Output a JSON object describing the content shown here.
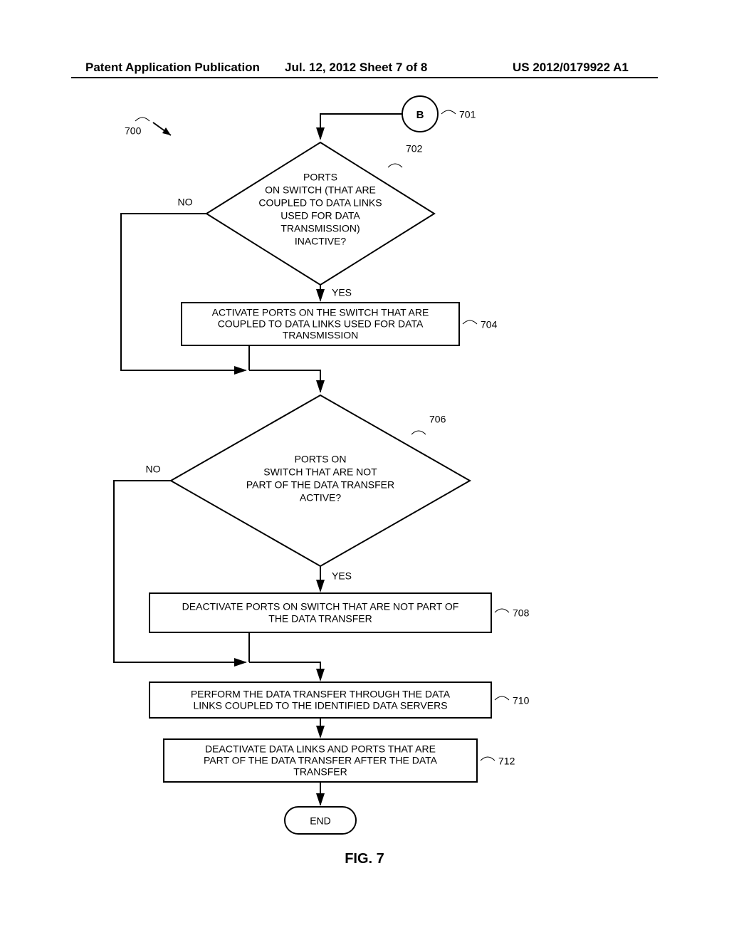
{
  "header": {
    "left": "Patent Application Publication",
    "mid": "Jul. 12, 2012  Sheet 7 of 8",
    "right": "US 2012/0179922 A1"
  },
  "labels": {
    "ref700": "700",
    "ref701": "701",
    "ref702": "702",
    "ref704": "704",
    "ref706": "706",
    "ref708": "708",
    "ref710": "710",
    "ref712": "712"
  },
  "nodes": {
    "start": "B",
    "d702_l1": "PORTS",
    "d702_l2": "ON SWITCH (THAT ARE",
    "d702_l3": "COUPLED TO DATA LINKS",
    "d702_l4": "USED FOR DATA",
    "d702_l5": "TRANSMISSION)",
    "d702_l6": "INACTIVE?",
    "p704_l1": "ACTIVATE PORTS ON THE SWITCH THAT ARE",
    "p704_l2": "COUPLED TO DATA LINKS USED FOR DATA",
    "p704_l3": "TRANSMISSION",
    "d706_l1": "PORTS ON",
    "d706_l2": "SWITCH THAT ARE NOT",
    "d706_l3": "PART OF THE DATA TRANSFER",
    "d706_l4": "ACTIVE?",
    "p708_l1": "DEACTIVATE PORTS ON SWITCH THAT ARE NOT PART OF",
    "p708_l2": "THE DATA TRANSFER",
    "p710_l1": "PERFORM THE DATA TRANSFER THROUGH THE DATA",
    "p710_l2": "LINKS COUPLED TO THE IDENTIFIED DATA SERVERS",
    "p712_l1": "DEACTIVATE DATA LINKS AND PORTS THAT ARE",
    "p712_l2": "PART OF THE DATA TRANSFER AFTER THE DATA",
    "p712_l3": "TRANSFER",
    "end": "END"
  },
  "edges": {
    "no": "NO",
    "yes": "YES"
  },
  "figure": "FIG. 7"
}
